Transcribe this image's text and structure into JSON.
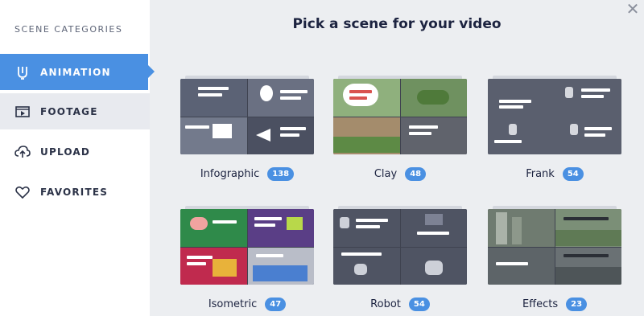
{
  "sidebar": {
    "title": "SCENE CATEGORIES",
    "items": [
      {
        "label": "ANIMATION",
        "icon": "animation-pen-icon"
      },
      {
        "label": "FOOTAGE",
        "icon": "footage-play-icon"
      },
      {
        "label": "UPLOAD",
        "icon": "upload-cloud-icon"
      },
      {
        "label": "FAVORITES",
        "icon": "heart-icon"
      }
    ]
  },
  "main": {
    "title": "Pick a scene for your video",
    "close_icon": "close-icon",
    "categories": [
      {
        "name": "Infographic",
        "count": "138"
      },
      {
        "name": "Clay",
        "count": "48"
      },
      {
        "name": "Frank",
        "count": "54"
      },
      {
        "name": "Isometric",
        "count": "47"
      },
      {
        "name": "Robot",
        "count": "54"
      },
      {
        "name": "Effects",
        "count": "23"
      }
    ]
  },
  "colors": {
    "accent": "#4a90e2",
    "background": "#eceef1",
    "sidebar": "#ffffff"
  }
}
